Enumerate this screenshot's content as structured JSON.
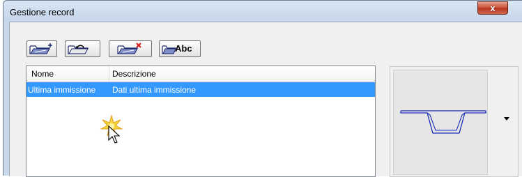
{
  "window": {
    "title": "Gestione record",
    "close_glyph": "x"
  },
  "toolbar": {
    "buttons": [
      {
        "name": "add-record",
        "icon": "folder-plus-icon"
      },
      {
        "name": "undo-record",
        "icon": "folder-undo-icon"
      },
      {
        "name": "delete-record",
        "icon": "folder-delete-icon"
      },
      {
        "name": "rename-record",
        "icon": "folder-rename-icon",
        "label": "Abc"
      }
    ]
  },
  "list": {
    "columns": [
      "Nome",
      "Descrizione"
    ],
    "rows": [
      {
        "nome": "Ultima immissione",
        "descrizione": "Dati ultima immissione",
        "selected": true
      }
    ]
  },
  "preview": {
    "icon": "cross-section-icon",
    "dropdown_icon": "dropdown-arrow-icon"
  },
  "colors": {
    "selection": "#3399ff",
    "close_button": "#c74b34",
    "section_line": "#1a2bb8"
  }
}
